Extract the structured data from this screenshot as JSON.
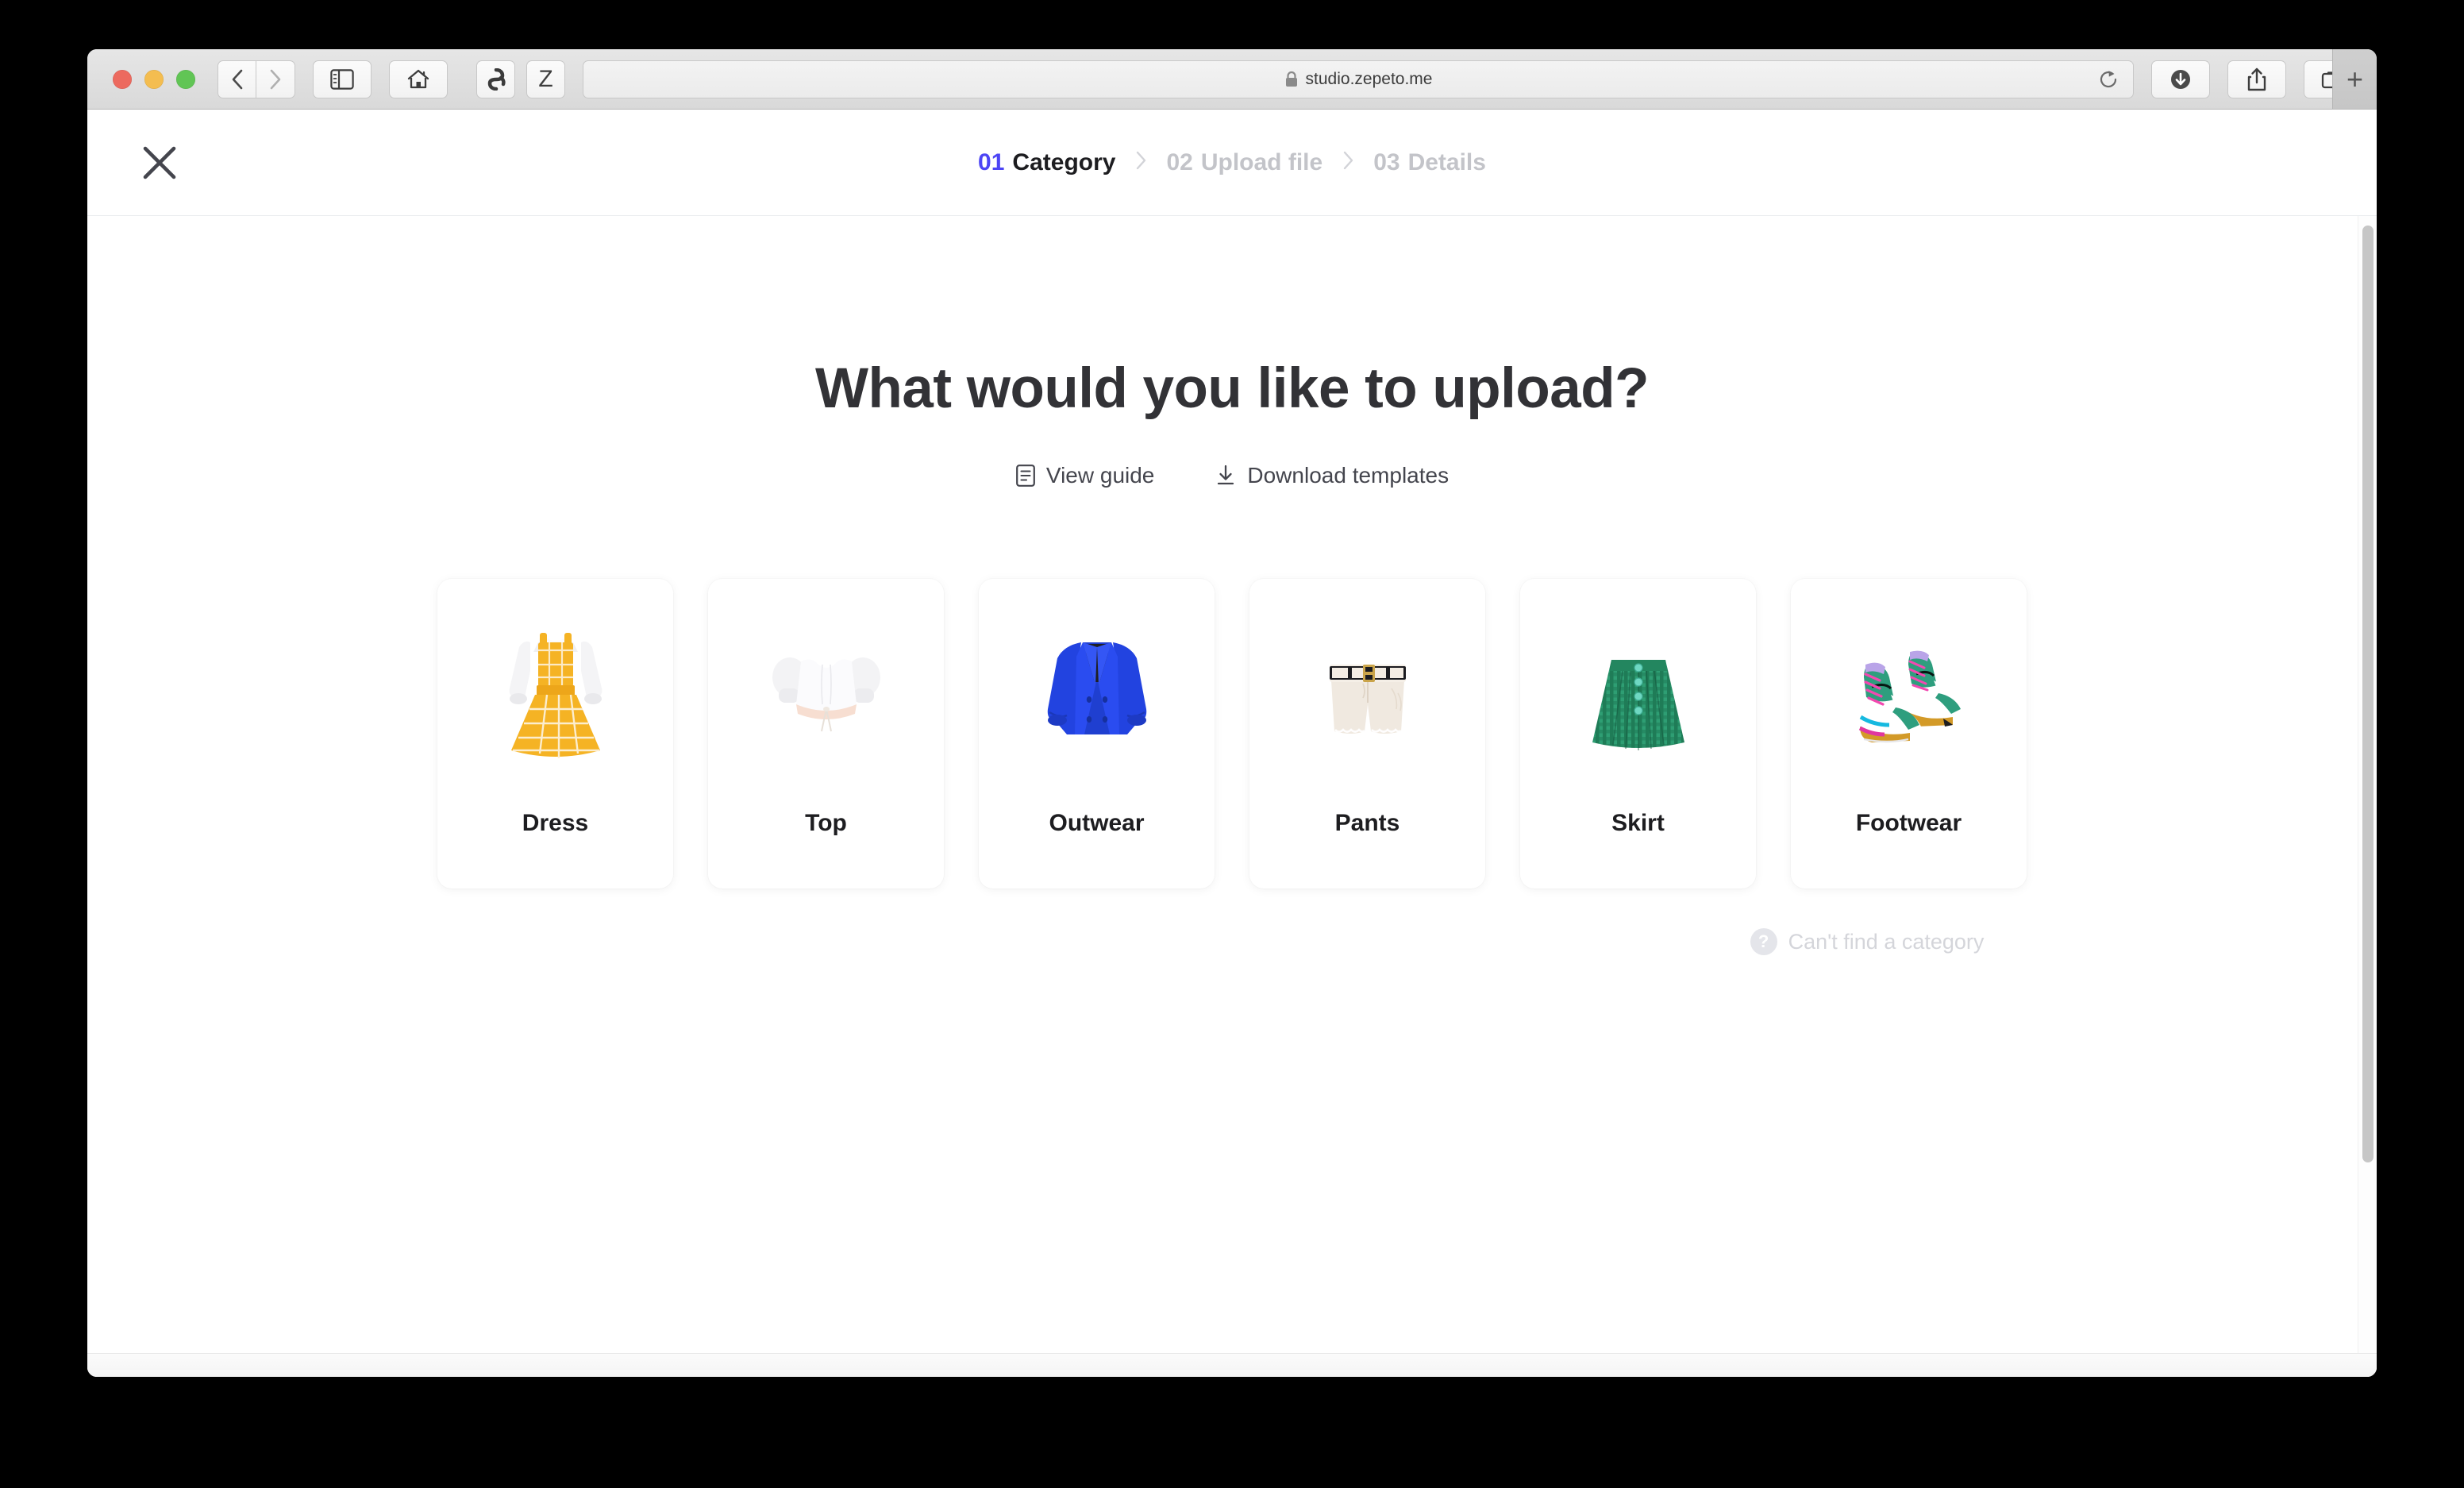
{
  "browser": {
    "url": "studio.zepeto.me",
    "lock_icon": "lock-icon",
    "traffic_lights": [
      "close",
      "minimize",
      "zoom"
    ],
    "nav": {
      "back_icon": "chevron-left-icon",
      "forward_icon": "chevron-right-icon",
      "sidebar_icon": "sidebar-icon",
      "home_icon": "home-icon"
    },
    "tabs": [
      {
        "name": "zepeto-logo-favicon",
        "glyph": ""
      },
      {
        "name": "z-favicon",
        "glyph": "Z"
      }
    ],
    "reload_icon": "reload-icon",
    "right_controls": {
      "downloads_icon": "downloads-icon",
      "share_icon": "share-icon",
      "tab_overview_icon": "tab-overview-icon",
      "new_tab_label": "+"
    }
  },
  "header": {
    "close_label": "Close",
    "steps": [
      {
        "num": "01",
        "label": "Category",
        "active": true
      },
      {
        "num": "02",
        "label": "Upload file",
        "active": false
      },
      {
        "num": "03",
        "label": "Details",
        "active": false
      }
    ],
    "separator": "›"
  },
  "main": {
    "title": "What would you like to upload?",
    "links": [
      {
        "label": "View guide",
        "icon": "document-guide-icon"
      },
      {
        "label": "Download templates",
        "icon": "download-icon"
      }
    ],
    "categories": [
      {
        "label": "Dress",
        "art": "dress-art"
      },
      {
        "label": "Top",
        "art": "top-art"
      },
      {
        "label": "Outwear",
        "art": "outwear-art"
      },
      {
        "label": "Pants",
        "art": "pants-art"
      },
      {
        "label": "Skirt",
        "art": "skirt-art"
      },
      {
        "label": "Footwear",
        "art": "footwear-art"
      }
    ],
    "helper": {
      "label": "Can't find a category",
      "badge": "?"
    }
  },
  "colors": {
    "accent": "#4d45f5",
    "title": "#323236",
    "muted": "#c3c4c9",
    "helper": "#d4d5da",
    "card_bg": "#ffffff",
    "divider": "#ebedf0"
  }
}
